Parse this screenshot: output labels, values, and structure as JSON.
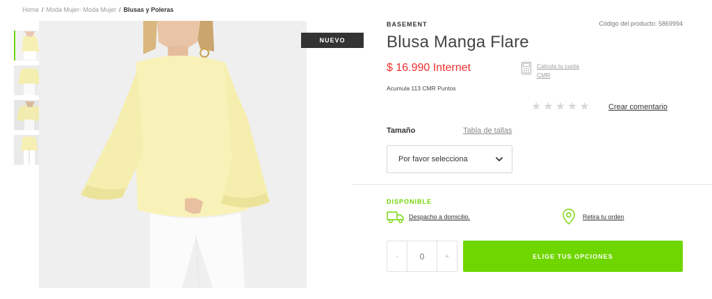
{
  "breadcrumb": {
    "items": [
      "Home",
      "Moda Mujer- Moda Mujer"
    ],
    "current": "Blusas y Poleras"
  },
  "gallery": {
    "thumbnails": [
      "thumbnail-1",
      "thumbnail-2",
      "thumbnail-3",
      "thumbnail-4"
    ],
    "active_index": 0,
    "badge": "NUEVO"
  },
  "product": {
    "brand": "BASEMENT",
    "code_label": "Código del producto: 5869994",
    "title": "Blusa Manga Flare",
    "price": "$ 16.990 Internet",
    "cmr_points": "Acumula 113 CMR Puntos",
    "cuota_link": "Calcula tu cuota CMR"
  },
  "rating": {
    "stars_filled": 0,
    "stars_total": 5,
    "comment_link": "Crear comentario"
  },
  "size": {
    "label": "Tamaño",
    "table_link": "Tabla de tallas",
    "select_value": "Por favor selecciona"
  },
  "availability": {
    "status": "DISPONIBLE",
    "delivery_link": "Despacho a domicilio.",
    "pickup_link": "Retira tu orden"
  },
  "purchase": {
    "minus": "-",
    "quantity": "0",
    "plus": "+",
    "cta_label": "ELIGE TUS OPCIONES"
  },
  "colors": {
    "accent_green": "#6fd600",
    "price_red": "#ef2d2d",
    "badge_dark": "#333333"
  }
}
